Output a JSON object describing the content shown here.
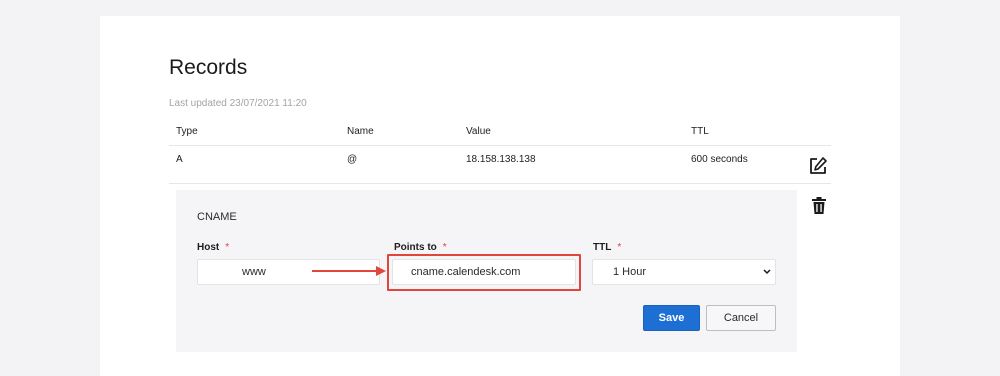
{
  "page": {
    "title": "Records",
    "last_updated": "Last updated 23/07/2021 11:20"
  },
  "table": {
    "columns": [
      "Type",
      "Name",
      "Value",
      "TTL"
    ],
    "rows": [
      {
        "type": "A",
        "name": "@",
        "value": "18.158.138.138",
        "ttl": "600 seconds"
      }
    ]
  },
  "edit_form": {
    "heading": "CNAME",
    "host": {
      "label": "Host",
      "value": "www"
    },
    "points_to": {
      "label": "Points to",
      "value": "cname.calendesk.com"
    },
    "ttl": {
      "label": "TTL",
      "selected": "1 Hour"
    },
    "required_marker": "*",
    "save_label": "Save",
    "cancel_label": "Cancel"
  },
  "icons": {
    "edit": "edit-icon",
    "delete": "trash-icon",
    "chevron": "chevron-down-icon",
    "arrow": "arrow-right-icon"
  },
  "colors": {
    "primary": "#1e6fd4",
    "required": "#e0413d",
    "highlight": "#e0463b"
  }
}
